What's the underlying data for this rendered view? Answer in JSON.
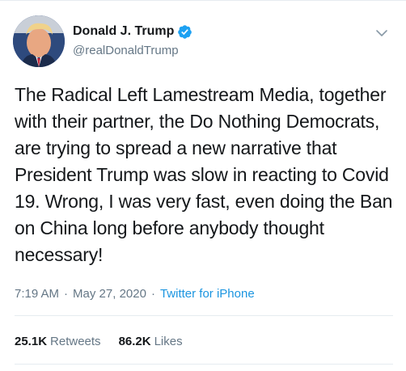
{
  "author": {
    "display_name": "Donald J. Trump",
    "handle": "@realDonaldTrump",
    "verified_icon": "verified-badge-icon"
  },
  "tweet": {
    "text": "The Radical Left Lamestream Media, together with their partner, the Do Nothing Democrats, are trying to spread a new narrative that President Trump was slow in reacting to Covid 19. Wrong, I was very fast, even doing the Ban on China long before anybody thought necessary!",
    "time": "7:19 AM",
    "date": "May 27, 2020",
    "separator": "·",
    "source": "Twitter for iPhone"
  },
  "stats": {
    "retweets_count": "25.1K",
    "retweets_label": "Retweets",
    "likes_count": "86.2K",
    "likes_label": "Likes"
  },
  "colors": {
    "text": "#14171a",
    "secondary": "#657786",
    "accent": "#1b95e0",
    "divider": "#e6ecf0"
  }
}
